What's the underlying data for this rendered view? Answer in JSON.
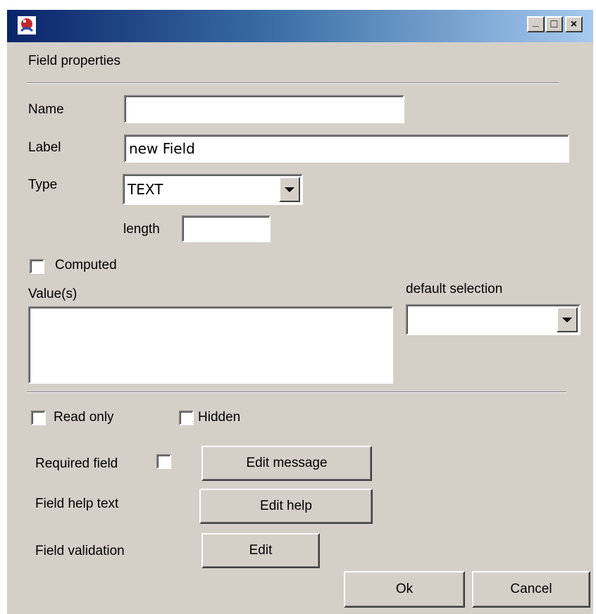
{
  "titlebar": {
    "title": "",
    "icon": "app-icon",
    "minimize_icon": "_",
    "maximize_icon": "□",
    "close_icon": "×"
  },
  "section_title": "Field properties",
  "name": {
    "label": "Name",
    "value": ""
  },
  "label_field": {
    "label": "Label",
    "value": "new Field"
  },
  "type": {
    "label": "Type",
    "value": "TEXT"
  },
  "length": {
    "label": "length",
    "value": ""
  },
  "computed": {
    "label": "Computed",
    "checked": false
  },
  "values": {
    "label": "Value(s)",
    "value": ""
  },
  "default_selection": {
    "label": "default selection",
    "value": ""
  },
  "read_only": {
    "label": "Read only",
    "checked": false
  },
  "hidden": {
    "label": "Hidden",
    "checked": false
  },
  "required": {
    "label": "Required field",
    "checked": false,
    "button": "Edit message"
  },
  "help": {
    "label": "Field help text",
    "button": "Edit help"
  },
  "validation": {
    "label": "Field validation",
    "button": "Edit"
  },
  "footer": {
    "ok": "Ok",
    "cancel": "Cancel"
  },
  "colors": {
    "window_bg": "#d4d0c8",
    "title_start": "#0a246a",
    "title_end": "#a6caf0"
  }
}
